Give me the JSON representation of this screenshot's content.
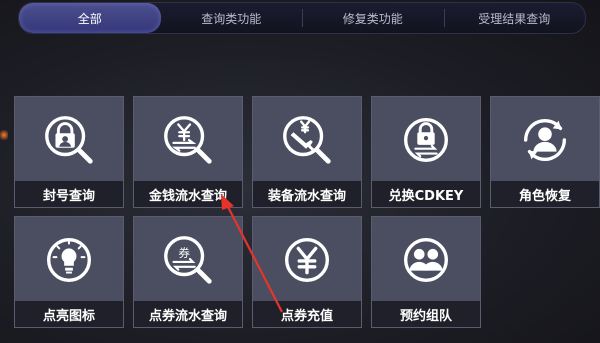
{
  "tabs": [
    {
      "label": "全部",
      "active": true
    },
    {
      "label": "查询类功能",
      "active": false
    },
    {
      "label": "修复类功能",
      "active": false
    },
    {
      "label": "受理结果查询",
      "active": false
    }
  ],
  "cards": [
    {
      "label": "封号查询",
      "icon": "lock-person-search-icon"
    },
    {
      "label": "金钱流水查询",
      "icon": "yen-transfer-search-icon"
    },
    {
      "label": "装备流水查询",
      "icon": "sword-yen-search-icon"
    },
    {
      "label": "兑换CDKEY",
      "icon": "lock-exchange-icon"
    },
    {
      "label": "角色恢复",
      "icon": "user-refresh-icon"
    },
    {
      "label": "点亮图标",
      "icon": "lightbulb-icon"
    },
    {
      "label": "点券流水查询",
      "icon": "coupon-search-icon"
    },
    {
      "label": "点券充值",
      "icon": "yen-coin-icon"
    },
    {
      "label": "预约组队",
      "icon": "team-group-icon"
    }
  ],
  "colors": {
    "accent_tab": "#3f4288",
    "card_bg": "#4b4e60",
    "label_bg": "#1f2029",
    "icon_stroke": "#ffffff",
    "annotation_arrow": "#e8332a"
  }
}
